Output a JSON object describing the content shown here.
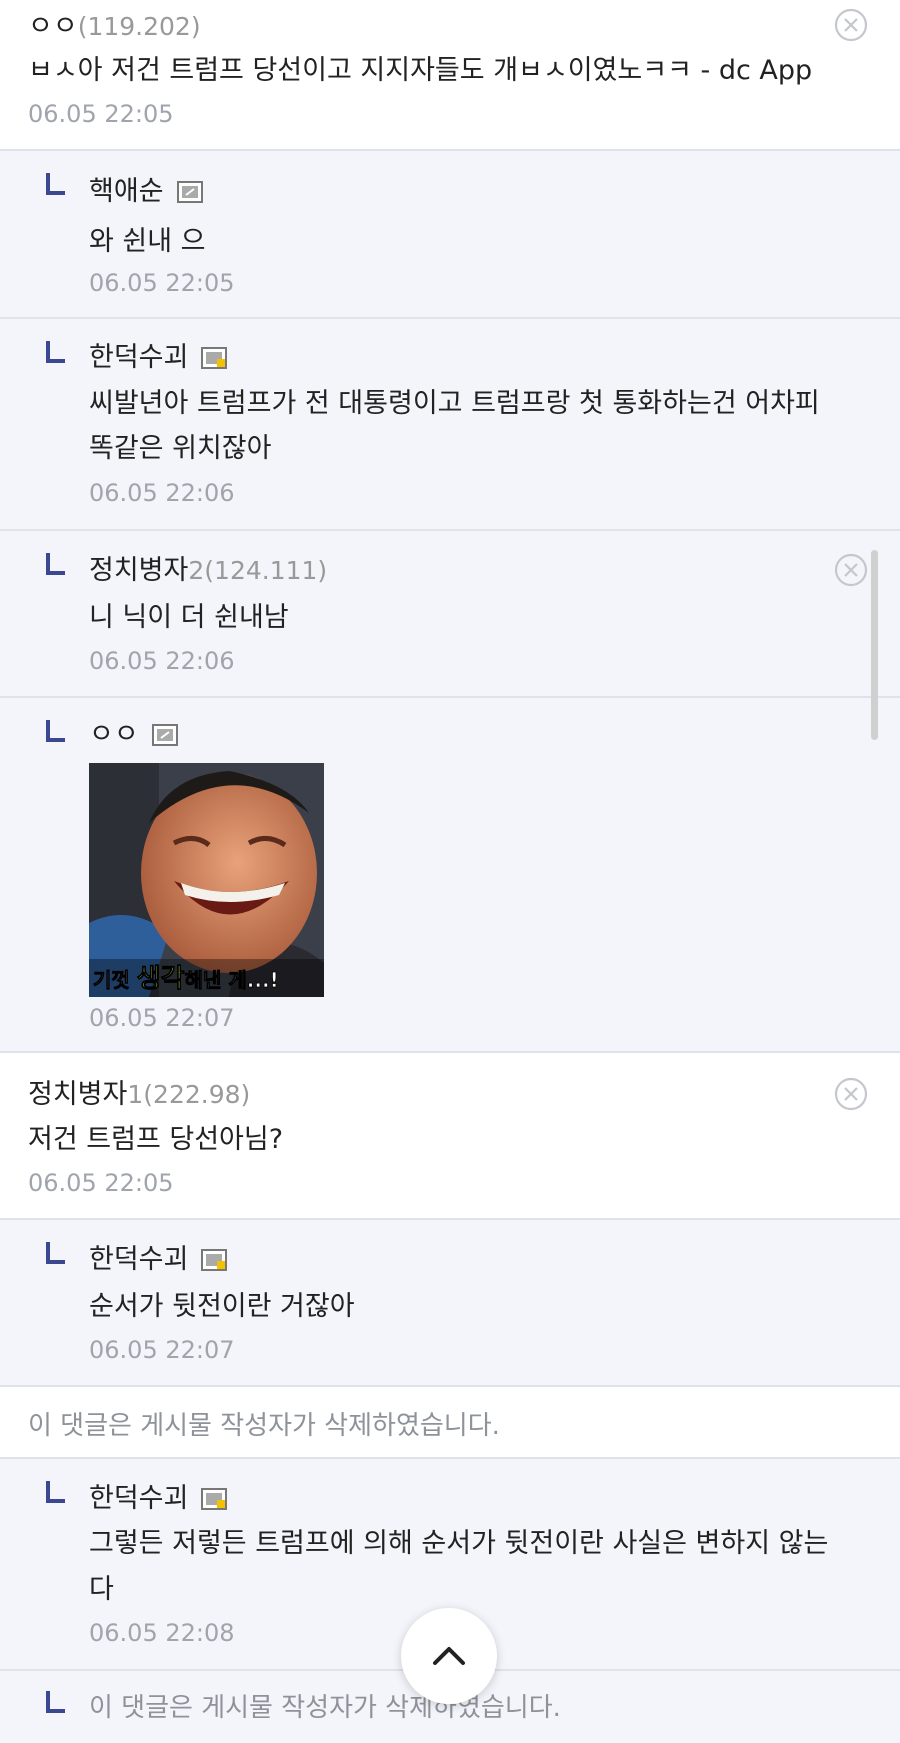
{
  "comments": [
    {
      "name": "ㅇㅇ",
      "ip": "(119.202)",
      "text": "ㅂㅅ아 저건 트럼프 당선이고 지지자들도 개ㅂㅅ이였노ㅋㅋ - dc App",
      "time": "06.05 22:05"
    },
    {
      "name": "핵애순",
      "text": "와 쉰내 으",
      "time": "06.05 22:05"
    },
    {
      "name": "한덕수괴",
      "text1": "씨발년아 트럼프가 전 대통령이고 트럼프랑 첫 통화하는건 어차피",
      "text2": "똑같은 위치잖아",
      "time": "06.05 22:06"
    },
    {
      "name": "정치병자",
      "name_suffix": "2",
      "ip": "(124.111)",
      "text": "니 닉이 더 쉰내남",
      "time": "06.05 22:06"
    },
    {
      "name": "ㅇㅇ",
      "image_caption_1": "기껏 ",
      "image_caption_2": "생각",
      "image_caption_3": "해낸 게...!",
      "time": "06.05 22:07"
    },
    {
      "name": "정치병자",
      "name_suffix": "1",
      "ip": "(222.98)",
      "text": "저건 트럼프 당선아님?",
      "time": "06.05 22:05"
    },
    {
      "name": "한덕수괴",
      "text": "순서가 뒷전이란 거잖아",
      "time": "06.05 22:07"
    },
    {
      "deleted_text": "이 댓글은 게시물 작성자가 삭제하였습니다."
    },
    {
      "name": "한덕수괴",
      "text1": "그렇든 저렇든 트럼프에 의해 순서가 뒷전이란 사실은 변하지 않는",
      "text2": "다",
      "time": "06.05 22:08"
    },
    {
      "deleted_text": "이 댓글은 게시물 작성자가 삭제하였습니다."
    }
  ],
  "icons": {
    "delete": "close-circle-icon",
    "scroll_top": "chevron-up-icon",
    "member_badge": "gallery-member-icon",
    "reply_marker": "reply-arrow-icon"
  },
  "colors": {
    "reply_bg": "#f4f5fb",
    "reply_marker": "#3b4890",
    "muted_text": "#a0a4ac",
    "divider": "#dfe2ea"
  }
}
